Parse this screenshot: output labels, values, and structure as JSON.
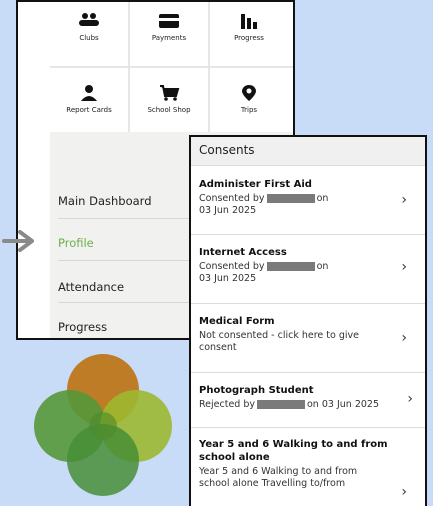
{
  "tiles": [
    {
      "label": "Clubs",
      "icon": "clubs-icon"
    },
    {
      "label": "Payments",
      "icon": "payments-icon"
    },
    {
      "label": "Progress",
      "icon": "progress-icon"
    },
    {
      "label": "Report Cards",
      "icon": "report-cards-icon"
    },
    {
      "label": "School Shop",
      "icon": "shop-cart-icon"
    },
    {
      "label": "Trips",
      "icon": "location-pin-icon"
    }
  ],
  "menu": {
    "items": [
      "Main Dashboard",
      "Profile",
      "Attendance",
      "Progress"
    ],
    "active": "Profile"
  },
  "consents": {
    "header": "Consents",
    "items": [
      {
        "title": "Administer First Aid",
        "line1_pre": "Consented by",
        "line1_post": "on",
        "line2": "03 Jun 2025"
      },
      {
        "title": "Internet Access",
        "line1_pre": "Consented by",
        "line1_post": "on",
        "line2": "03 Jun 2025"
      },
      {
        "title": "Medical Form",
        "line1": "Not consented - click here to give",
        "line2": "consent"
      },
      {
        "title": "Photograph Student",
        "line1_pre": "Rejected by",
        "line1_post": "on 03 Jun 2025"
      },
      {
        "title_line1": "Year 5 and 6 Walking to and from",
        "title_line2": "school alone",
        "line1": "Year 5 and 6 Walking to and from",
        "line2": "school alone Travelling to/from"
      }
    ]
  },
  "colors": {
    "accent_green": "#6bb04a",
    "logo_orange": "#f08a1c",
    "logo_yellow_green": "#c8d632",
    "logo_green": "#5aa63a"
  }
}
